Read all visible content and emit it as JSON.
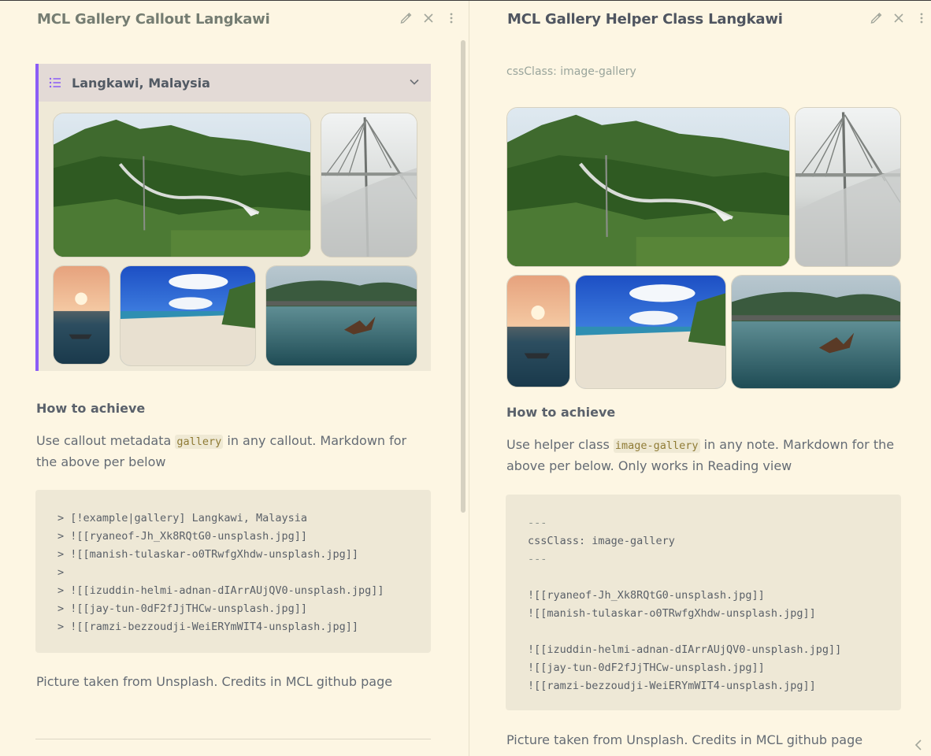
{
  "left": {
    "title": "MCL Gallery Callout Langkawi",
    "callout": {
      "title": "Langkawi, Malaysia"
    },
    "heading": "How to achieve",
    "para": {
      "prefix": "Use callout metadata ",
      "code": "gallery",
      "suffix": " in any callout. Markdown for the above per below"
    },
    "code_lines": [
      "> [!example|gallery] Langkawi, Malaysia",
      "> ![[ryaneof-Jh_Xk8RQtG0-unsplash.jpg]]",
      "> ![[manish-tulaskar-o0TRwfgXhdw-unsplash.jpg]]",
      ">",
      "> ![[izuddin-helmi-adnan-dIArrAUjQV0-unsplash.jpg]]",
      "> ![[jay-tun-0dF2fJjTHCw-unsplash.jpg]]",
      "> ![[ramzi-bezzoudji-WeiERYmWIT4-unsplash.jpg]]"
    ],
    "footer": "Picture taken from Unsplash. Credits in MCL github page"
  },
  "right": {
    "title": "MCL Gallery Helper Class Langkawi",
    "property": "cssClass: image-gallery",
    "heading": "How to achieve",
    "para": {
      "prefix": "Use helper class ",
      "code": "image-gallery",
      "suffix": " in any note. Markdown for the above per below. Only works in Reading view"
    },
    "code_lines": [
      "---",
      "cssClass: image-gallery",
      "---",
      "",
      "![[ryaneof-Jh_Xk8RQtG0-unsplash.jpg]]",
      "![[manish-tulaskar-o0TRwfgXhdw-unsplash.jpg]]",
      "",
      "![[izuddin-helmi-adnan-dIArrAUjQV0-unsplash.jpg]]",
      "![[jay-tun-0dF2fJjTHCw-unsplash.jpg]]",
      "![[ramzi-bezzoudji-WeiERYmWIT4-unsplash.jpg]]"
    ],
    "footer": "Picture taken from Unsplash. Credits in MCL github page"
  },
  "icons": {
    "edit": "pencil-icon",
    "close": "close-icon",
    "more": "more-vertical-icon",
    "callout": "list-icon",
    "fold": "chevron-down-icon",
    "collapse": "chevron-left-icon"
  },
  "colors": {
    "background": "#fdf6e3",
    "callout_accent": "#8b5cf6",
    "callout_title_bg": "#e3dad6",
    "code_bg": "#eee8d6",
    "inline_code_text": "#8f7b35"
  }
}
